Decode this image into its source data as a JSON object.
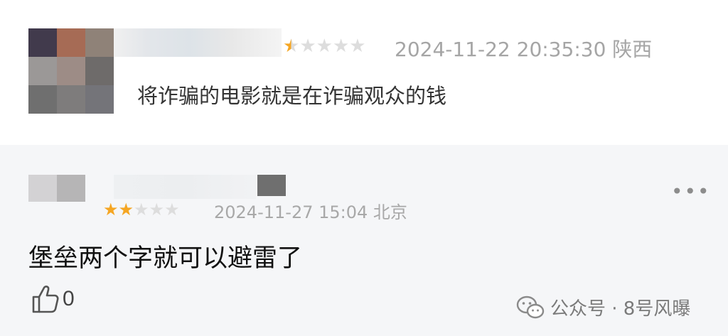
{
  "reviews": [
    {
      "stars_filled": 0.5,
      "stars_total": 5,
      "timestamp": "2024-11-22 20:35:30",
      "location": "陕西",
      "text": "将诈骗的电影就是在诈骗观众的钱"
    },
    {
      "stars_filled": 2,
      "stars_total": 5,
      "timestamp": "2024-11-27 15:04",
      "location": "北京",
      "text": "堡垒两个字就可以避雷了",
      "likes": "0",
      "more_label": "•••"
    }
  ],
  "watermark": {
    "text": "公众号 · 8号风曝",
    "icon": "wechat-icon"
  },
  "colors": {
    "star_on": "#f5a623",
    "star_off": "#dddddd",
    "meta": "#a8a8a8"
  }
}
